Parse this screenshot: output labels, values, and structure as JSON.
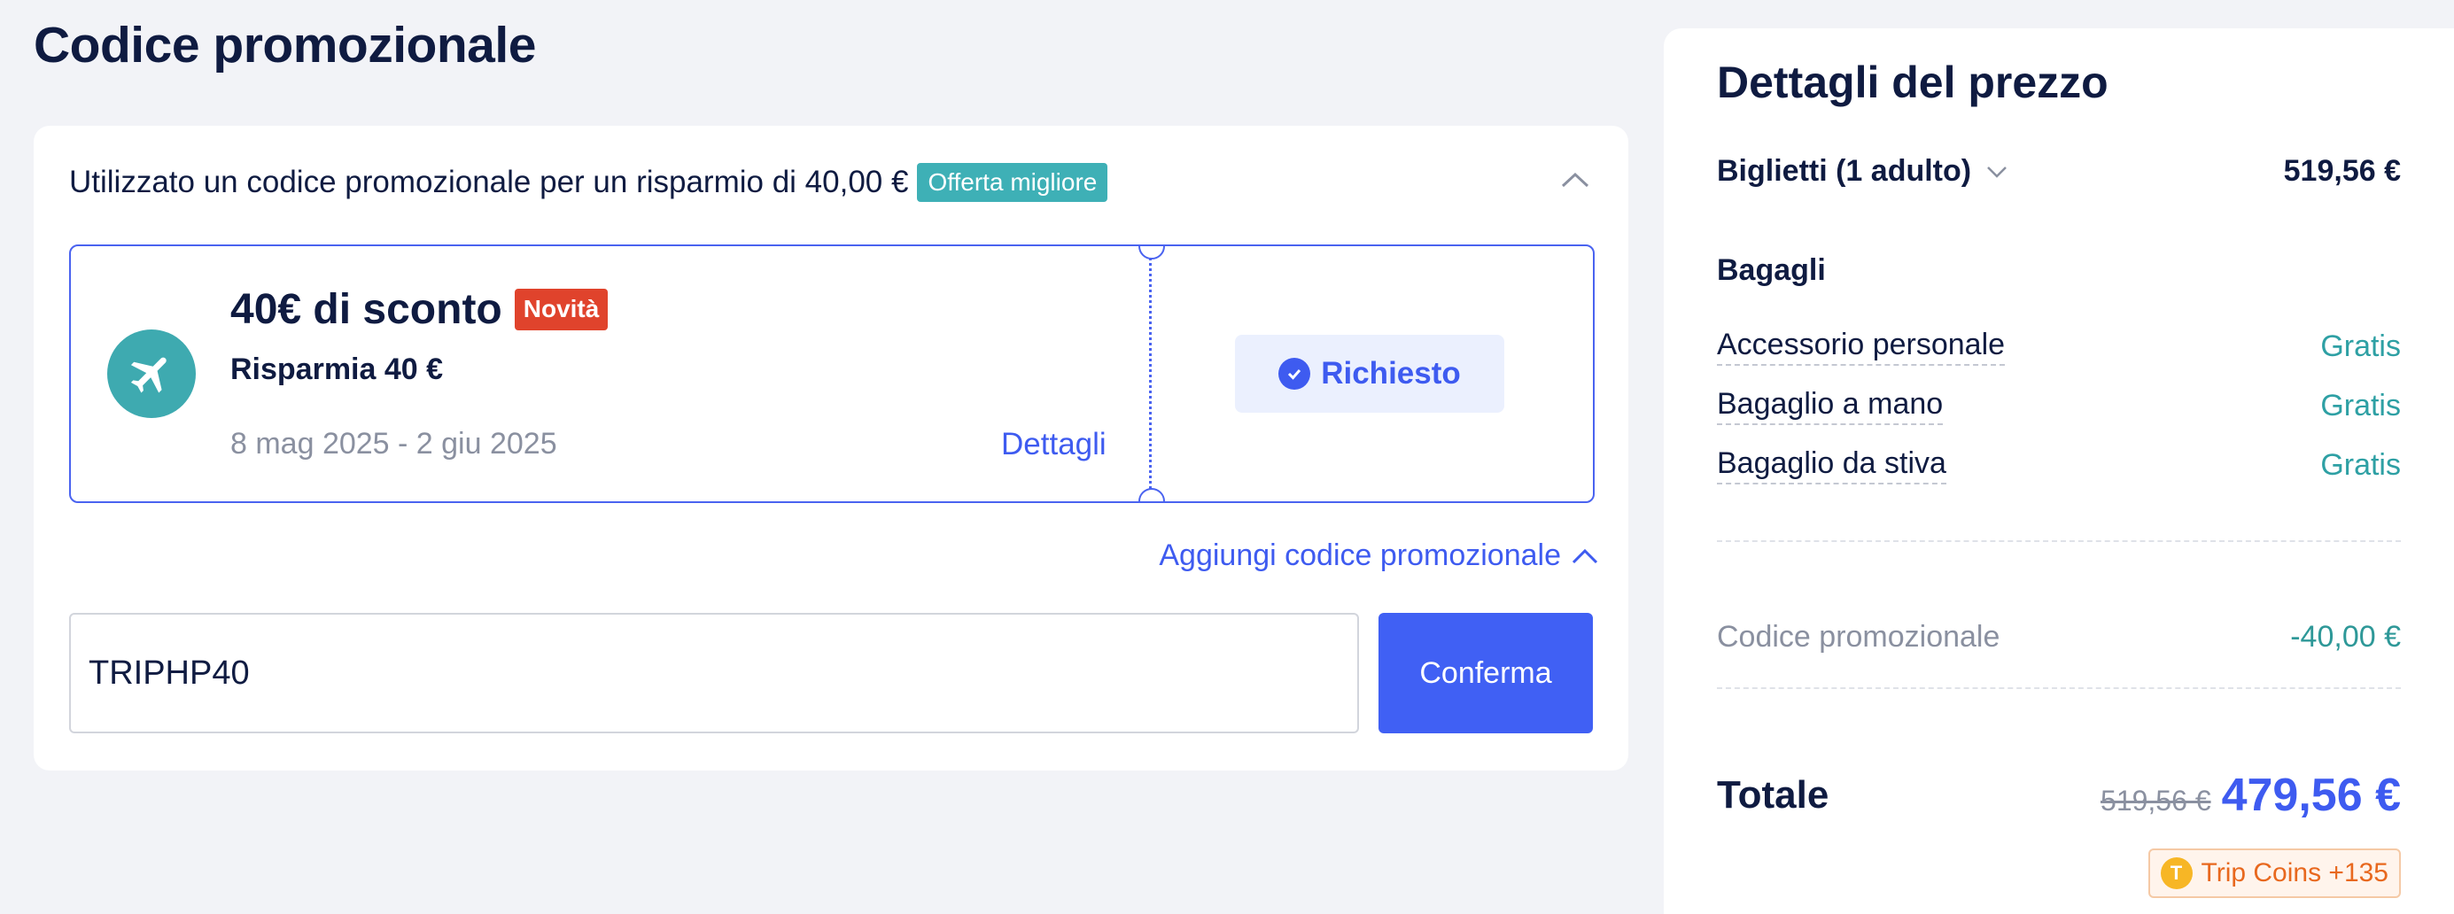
{
  "promo_section": {
    "title": "Codice promozionale",
    "summary": "Utilizzato un codice promozionale per un risparmio di 40,00 €",
    "best_offer_badge": "Offerta migliore",
    "coupon": {
      "title": "40€ di sconto",
      "new_badge": "Novità",
      "subtitle": "Risparmia 40 €",
      "dates": "8 mag 2025 - 2 giu 2025",
      "details_link": "Dettagli",
      "claimed_label": "Richiesto",
      "icon": "airplane-icon"
    },
    "add_code_link": "Aggiungi codice promozionale",
    "code_input_value": "TRIPHP40",
    "confirm_label": "Conferma"
  },
  "price_details": {
    "title": "Dettagli del prezzo",
    "tickets_label": "Biglietti (1 adulto)",
    "tickets_amount": "519,56 €",
    "baggage_heading": "Bagagli",
    "baggage_items": [
      {
        "label": "Accessorio personale",
        "value": "Gratis"
      },
      {
        "label": "Bagaglio a mano",
        "value": "Gratis"
      },
      {
        "label": "Bagaglio da stiva",
        "value": "Gratis"
      }
    ],
    "promo_label": "Codice promozionale",
    "promo_amount": "-40,00 €",
    "total_label": "Totale",
    "old_total": "519,56 €",
    "new_total": "479,56 €",
    "coins_label": "Trip Coins +135",
    "coin_icon_letter": "T"
  },
  "colors": {
    "accent": "#3e5bf0",
    "teal": "#3eaab0",
    "new_badge": "#e0432c",
    "coins": "#e8681e"
  }
}
